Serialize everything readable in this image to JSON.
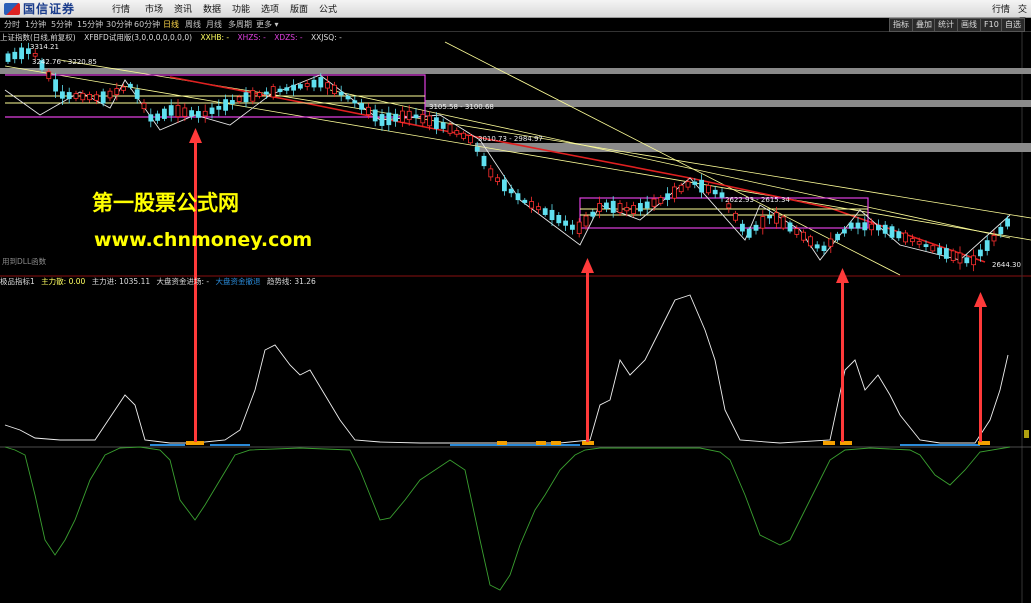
{
  "app": {
    "logo_text": "国信证券"
  },
  "menubar": {
    "items": [
      "行情",
      "市场",
      "资讯",
      "数据",
      "功能",
      "选项",
      "版面",
      "公式"
    ],
    "right_items": [
      "行情",
      "交易"
    ]
  },
  "toolbar": {
    "periods": [
      "分时",
      "1分钟",
      "5分钟",
      "15分钟",
      "30分钟",
      "60分钟",
      "日线",
      "周线",
      "月线",
      "多周期",
      "更多 ▾"
    ],
    "active": "日线",
    "right_buttons": [
      "指标",
      "叠加",
      "统计",
      "画线",
      "F10",
      "自选"
    ]
  },
  "infobar": {
    "title": "上证指数(日线,前复权)",
    "formula": "XFBFD试用版(3,0,0,0,0,0,0,0)",
    "xxhb": "XXHB: -",
    "xhzs": "XHZS: -",
    "xdzs": "XDZS: -",
    "xxjsq": "XXJSQ: -"
  },
  "price_labels": {
    "high_top": "3314.21",
    "box1": "3242.76 - 3220.85",
    "box2": "3105.58 - 3100.68",
    "box3": "3010.73 - 2984.97",
    "box4": "2622.93 - 2615.34",
    "low": "2644.30"
  },
  "watermark": {
    "line1": "第一股票公式网",
    "line2": "www.chnmoney.com"
  },
  "side_label": "用到DLL函数",
  "indicator": {
    "name": "极品指标1",
    "main_sell": "主力散: 0.00",
    "main_in": "主力进: 1035.11",
    "big_flow": "大盘资金进场: -",
    "big_flow2": "大盘资金撤退",
    "trend": "趋势线: 31.26"
  },
  "colors": {
    "yellow_box": "#ffff99",
    "magenta": "#e040e0",
    "red_trend": "#e02020",
    "up_candle": "#ff3030",
    "down_candle": "#60e0f0",
    "white_line": "#f0f0f0",
    "green_line": "#3aa030",
    "orange_bar": "#f5a000",
    "blue_bar": "#2a8ad8",
    "arrow": "#ff3a3a"
  }
}
